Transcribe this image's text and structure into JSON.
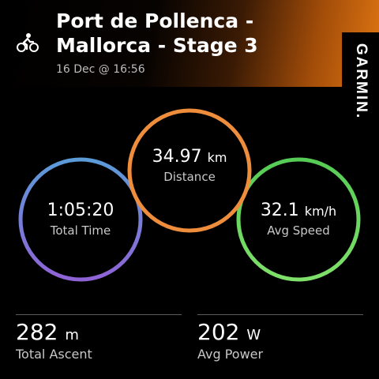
{
  "activity": {
    "icon": "bicycle-icon",
    "title": "Port de Pollenca - Mallorca - Stage 3",
    "date": "16 Dec @ 16:56"
  },
  "brand": {
    "logo": "GARMIN."
  },
  "rings": {
    "total_time": {
      "value": "1:05:20",
      "unit": "",
      "label": "Total Time",
      "color_start": "#5b9bd8",
      "color_end": "#8f63d6"
    },
    "distance": {
      "value": "34.97",
      "unit": "km",
      "label": "Distance",
      "color": "#ee8e3d"
    },
    "avg_speed": {
      "value": "32.1",
      "unit": "km/h",
      "label": "Avg Speed",
      "color_start": "#5cd44c",
      "color_end": "#7fe06a"
    }
  },
  "stats": {
    "total_ascent": {
      "value": "282",
      "unit": "m",
      "label": "Total Ascent"
    },
    "avg_power": {
      "value": "202",
      "unit": "W",
      "label": "Avg Power"
    }
  }
}
